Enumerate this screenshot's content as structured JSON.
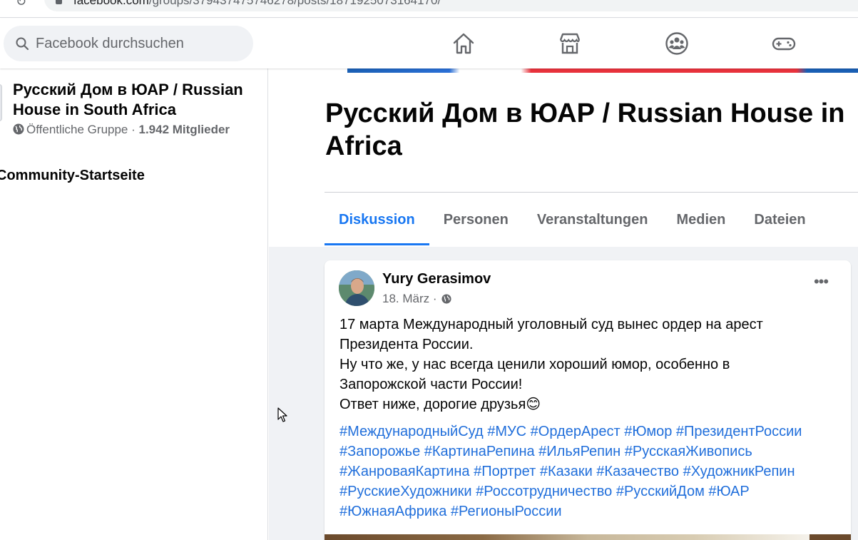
{
  "browser": {
    "url_domain": "facebook.com",
    "url_path": "/groups/379437475746278/posts/1871925073164170/"
  },
  "search": {
    "placeholder": "Facebook durchsuchen"
  },
  "nav": {
    "icons": [
      "home-icon",
      "marketplace-icon",
      "groups-icon",
      "gaming-icon"
    ]
  },
  "sidebar": {
    "group_name": "Русский Дом в ЮАР / Russian House in South Africa",
    "privacy": "Öffentliche Gruppe",
    "separator": " · ",
    "members": "1.942 Mitglieder",
    "community_home": "Community-Startseite"
  },
  "header": {
    "title_line1": "Русский Дом в ЮАР / Russian House in",
    "title_line2": "Africa",
    "tabs": [
      {
        "label": "Diskussion",
        "active": true
      },
      {
        "label": "Personen",
        "active": false
      },
      {
        "label": "Veranstaltungen",
        "active": false
      },
      {
        "label": "Medien",
        "active": false
      },
      {
        "label": "Dateien",
        "active": false
      }
    ]
  },
  "post": {
    "author": "Yury Gerasimov",
    "date": "18. März ·",
    "more_label": "•••",
    "text_lines": [
      "17 марта Международный уголовный суд вынес ордер на арест",
      "Президента России.",
      "Ну что же, у нас всегда ценили хороший юмор, особенно в",
      "Запорожской части России!",
      "Ответ ниже, дорогие друзья😊"
    ],
    "hashtag_lines": [
      "#МеждународныйСуд #МУС #ОрдерАрест #Юмор #ПрезидентРоссии",
      "#Запорожье #КартинаРепина #ИльяРепин #РусскаяЖивопись",
      "#ЖанроваяКартина #Портрет #Казаки #Казачество #ХудожникРепин",
      "#РусскиеХудожники #Россотрудничество #РусскийДом #ЮАР",
      "#ЮжнаяАфрика #РегионыРоссии"
    ]
  }
}
